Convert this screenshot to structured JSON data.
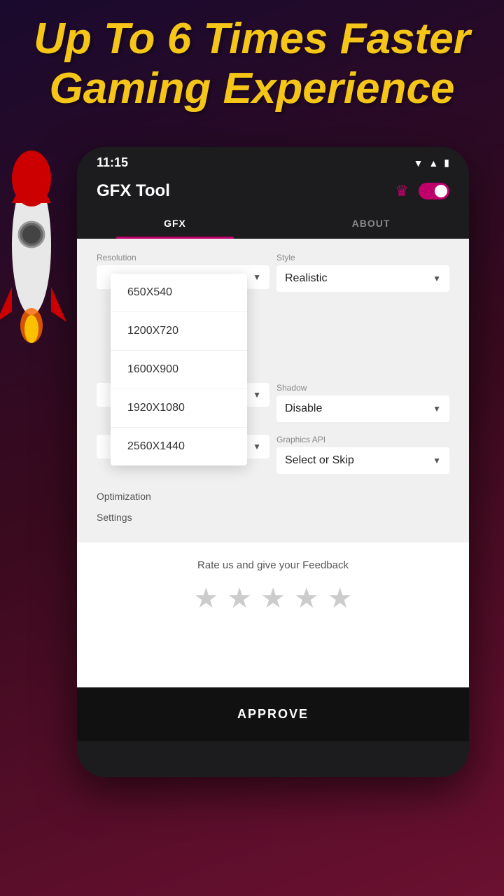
{
  "hero": {
    "title_line1": "Up To 6 Times Faster",
    "title_line2": "Gaming Experience"
  },
  "phone": {
    "status_bar": {
      "time": "11:15",
      "icons": [
        "wifi",
        "signal",
        "battery"
      ]
    },
    "header": {
      "app_title": "GFX Tool",
      "crown_icon": "👑",
      "toggle_on": true
    },
    "tabs": [
      {
        "label": "GFX",
        "active": true
      },
      {
        "label": "ABOUT",
        "active": false
      }
    ],
    "settings": {
      "resolution_label": "Resolution",
      "resolution_value": "",
      "style_label": "Style",
      "style_value": "Realistic",
      "shadow_label": "Shadow",
      "shadow_value": "Disable",
      "graphics_api_label": "Graphics API",
      "graphics_api_value": "Select or Skip",
      "optimization_label": "Optimization",
      "settings_label": "Settings"
    },
    "resolution_dropdown": {
      "items": [
        "650X540",
        "1200X720",
        "1600X900",
        "1920X1080",
        "2560X1440"
      ]
    },
    "feedback": {
      "text": "Rate us and give your Feedback",
      "stars": [
        0,
        0,
        0,
        0,
        0
      ]
    },
    "approve_button": "APPROVE"
  }
}
